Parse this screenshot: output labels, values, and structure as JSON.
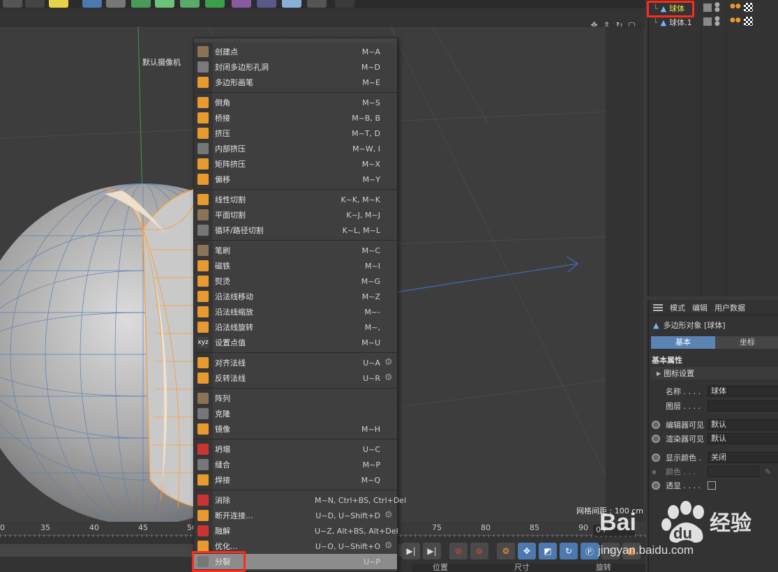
{
  "viewport": {
    "camera_label": "默认摄像机",
    "grid_spacing": "网格间距 : 100 cm"
  },
  "object_manager": {
    "objects": [
      {
        "name": "球体",
        "selected": true
      },
      {
        "name": "球体.1",
        "selected": false
      }
    ]
  },
  "attributes": {
    "menu": [
      "模式",
      "编辑",
      "用户数据"
    ],
    "title": "多边形对象 [球体]",
    "tabs": [
      "基本",
      "坐标"
    ],
    "section": "基本属性",
    "subsection": "图标设置",
    "fields": {
      "name_label": "名称 . . . .",
      "name_value": "球体",
      "layer_label": "图层 . . . .",
      "layer_value": "",
      "editor_visible_label": "编辑器可见",
      "editor_visible_value": "默认",
      "render_visible_label": "渲染器可见",
      "render_visible_value": "默认",
      "display_color_label": "显示颜色 .",
      "display_color_value": "关闭",
      "color_label": "颜色 . . .",
      "transparent_label": "透显 . . . ."
    }
  },
  "context_menu": {
    "groups": [
      [
        {
          "label": "创建点",
          "shortcut": "M~A",
          "icon": "create-point-icon",
          "color": "#8b7355"
        },
        {
          "label": "封闭多边形孔洞",
          "shortcut": "M~D",
          "icon": "close-hole-icon",
          "color": "#7a7a7a"
        },
        {
          "label": "多边形画笔",
          "shortcut": "M~E",
          "icon": "polygon-pen-icon",
          "color": "#e89a2e"
        }
      ],
      [
        {
          "label": "倒角",
          "shortcut": "M~S",
          "icon": "bevel-icon",
          "color": "#e89a2e"
        },
        {
          "label": "桥接",
          "shortcut": "M~B, B",
          "icon": "bridge-icon",
          "color": "#e89a2e"
        },
        {
          "label": "挤压",
          "shortcut": "M~T, D",
          "icon": "extrude-icon",
          "color": "#e89a2e"
        },
        {
          "label": "内部挤压",
          "shortcut": "M~W, I",
          "icon": "extrude-inner-icon",
          "color": "#777"
        },
        {
          "label": "矩阵挤压",
          "shortcut": "M~X",
          "icon": "matrix-extrude-icon",
          "color": "#e89a2e"
        },
        {
          "label": "偏移",
          "shortcut": "M~Y",
          "icon": "offset-icon",
          "color": "#e89a2e"
        }
      ],
      [
        {
          "label": "线性切割",
          "shortcut": "K~K, M~K",
          "icon": "line-cut-icon",
          "color": "#e89a2e"
        },
        {
          "label": "平面切割",
          "shortcut": "K~J, M~J",
          "icon": "plane-cut-icon",
          "color": "#8b7355"
        },
        {
          "label": "循环/路径切割",
          "shortcut": "K~L, M~L",
          "icon": "loop-cut-icon",
          "color": "#777"
        }
      ],
      [
        {
          "label": "笔刷",
          "shortcut": "M~C",
          "icon": "brush-icon",
          "color": "#8b7355"
        },
        {
          "label": "磁铁",
          "shortcut": "M~I",
          "icon": "magnet-icon",
          "color": "#e89a2e"
        },
        {
          "label": "熨烫",
          "shortcut": "M~G",
          "icon": "iron-icon",
          "color": "#e89a2e"
        },
        {
          "label": "沿法线移动",
          "shortcut": "M~Z",
          "icon": "normal-move-icon",
          "color": "#e89a2e"
        },
        {
          "label": "沿法线缩放",
          "shortcut": "M~-",
          "icon": "normal-scale-icon",
          "color": "#e89a2e"
        },
        {
          "label": "沿法线旋转",
          "shortcut": "M~,",
          "icon": "normal-rotate-icon",
          "color": "#e89a2e"
        },
        {
          "label": "设置点值",
          "shortcut": "M~U",
          "icon": "set-point-value-icon",
          "color": "#444",
          "text": "xyz"
        }
      ],
      [
        {
          "label": "对齐法线",
          "shortcut": "U~A",
          "icon": "align-normals-icon",
          "color": "#e89a2e",
          "gear": true
        },
        {
          "label": "反转法线",
          "shortcut": "U~R",
          "icon": "reverse-normals-icon",
          "color": "#e89a2e",
          "gear": true
        }
      ],
      [
        {
          "label": "阵列",
          "shortcut": "",
          "icon": "array-icon",
          "color": "#8b7355"
        },
        {
          "label": "克隆",
          "shortcut": "",
          "icon": "clone-icon",
          "color": "#777"
        },
        {
          "label": "镜像",
          "shortcut": "M~H",
          "icon": "mirror-icon",
          "color": "#e89a2e"
        }
      ],
      [
        {
          "label": "坍塌",
          "shortcut": "U~C",
          "icon": "collapse-icon",
          "color": "#c33"
        },
        {
          "label": "缝合",
          "shortcut": "M~P",
          "icon": "stitch-icon",
          "color": "#777"
        },
        {
          "label": "焊接",
          "shortcut": "M~Q",
          "icon": "weld-icon",
          "color": "#e89a2e"
        }
      ],
      [
        {
          "label": "消除",
          "shortcut": "M~N, Ctrl+BS, Ctrl+Del",
          "icon": "dissolve-icon",
          "color": "#c33"
        },
        {
          "label": "断开连接...",
          "shortcut": "U~D, U~Shift+D",
          "icon": "disconnect-icon",
          "color": "#e89a2e",
          "gear": true
        },
        {
          "label": "融解",
          "shortcut": "U~Z, Alt+BS, Alt+Del",
          "icon": "melt-icon",
          "color": "#c33"
        },
        {
          "label": "优化...",
          "shortcut": "U~O, U~Shift+O",
          "icon": "optimize-icon",
          "color": "#e89a2e",
          "gear": true
        },
        {
          "label": "分裂",
          "shortcut": "U~P",
          "icon": "split-icon",
          "color": "#777",
          "active": true
        }
      ]
    ]
  },
  "timeline": {
    "ruler_numbers": [
      "0",
      "35",
      "40",
      "45",
      "50",
      "75",
      "80",
      "85",
      "90"
    ],
    "frame_field": "0 F",
    "bottom_headers": [
      "位置",
      "尺寸",
      "旋转"
    ]
  },
  "watermark": {
    "brand": "Bai",
    "brand2": "du",
    "product": "经验",
    "url": "jingyan.baidu.com"
  },
  "colors": {
    "accent_blue": "#5b84b5",
    "highlight_red": "#ff2a1a",
    "selection_orange": "#ff9c2b"
  }
}
